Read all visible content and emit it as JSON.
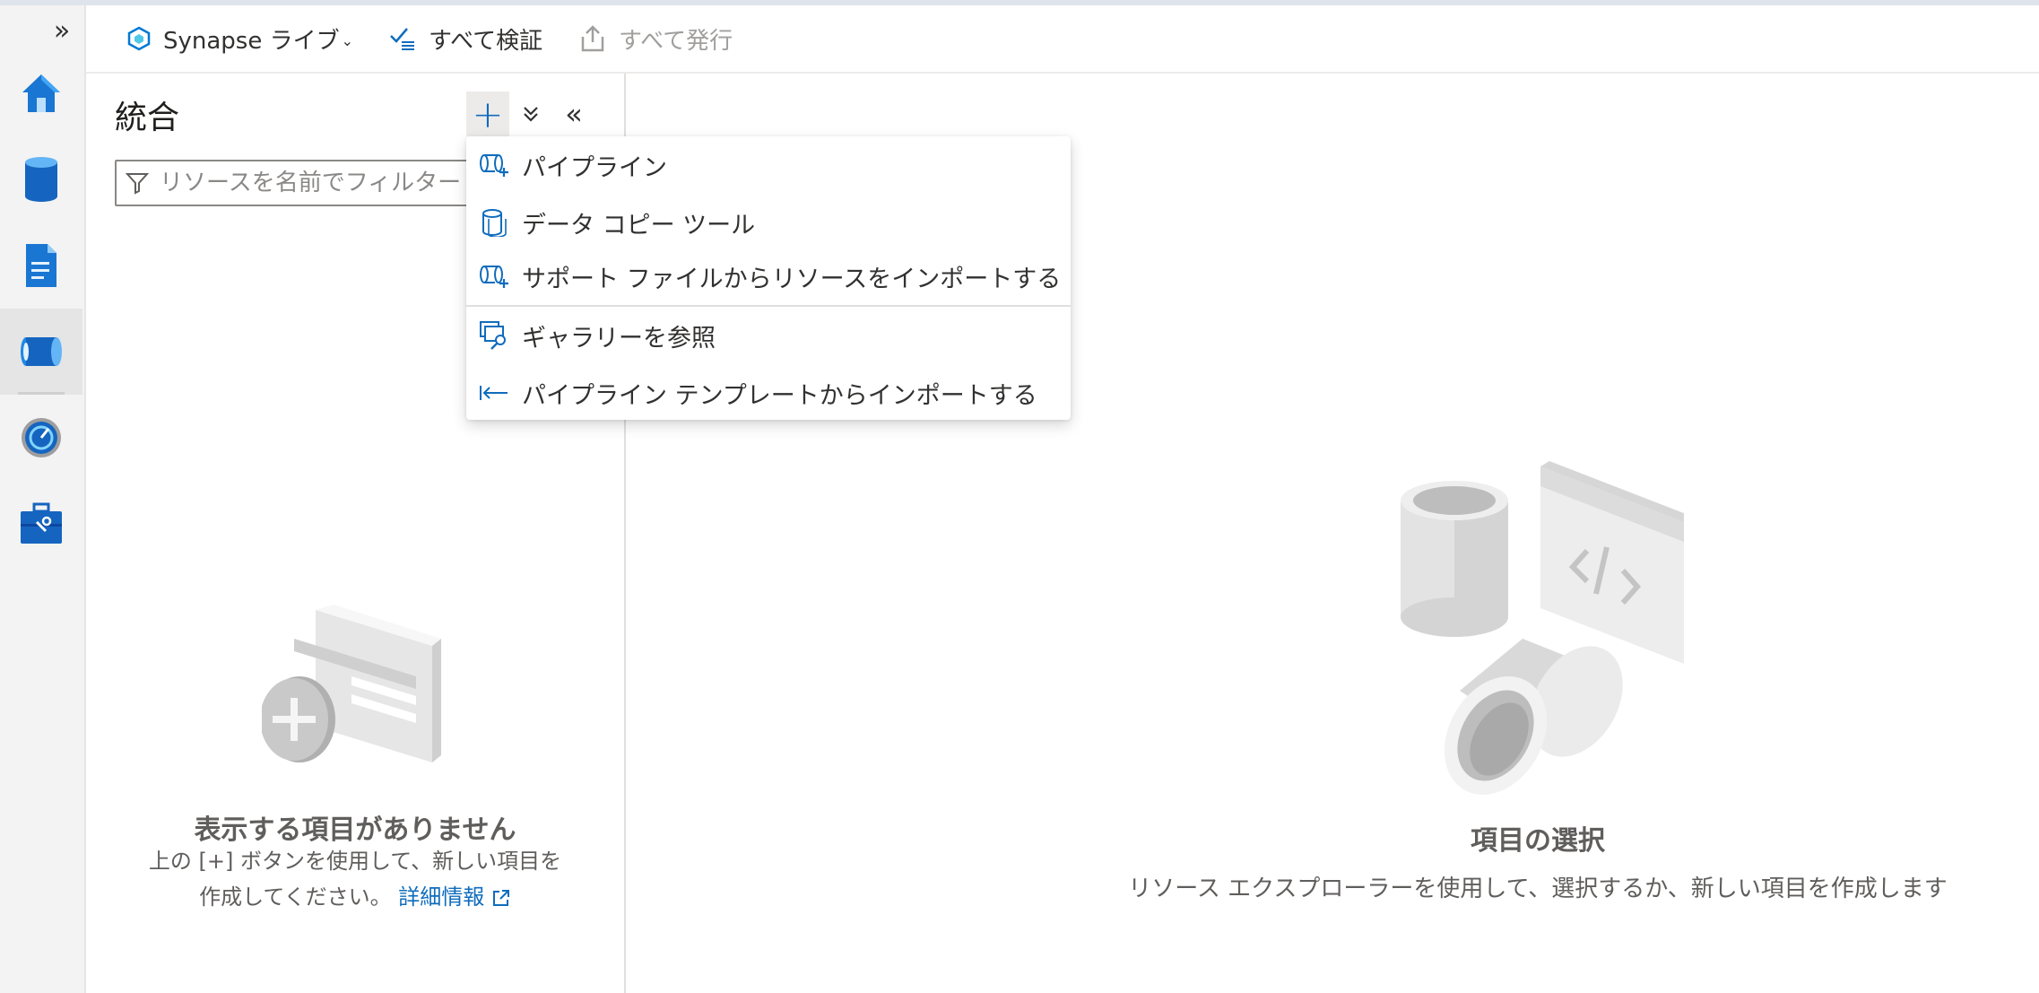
{
  "command_bar": {
    "synapse_live_label": "Synapse ライブ",
    "validate_all_label": "すべて検証",
    "publish_all_label": "すべて発行"
  },
  "explorer": {
    "title": "統合",
    "filter_placeholder": "リソースを名前でフィルター",
    "empty_title": "表示する項目がありません",
    "empty_line1": "上の [+] ボタンを使用して、新しい項目を",
    "empty_line2": "作成してください。",
    "learn_more": "詳細情報"
  },
  "add_menu": {
    "items": [
      {
        "label": "パイプライン",
        "icon": "pipeline-icon"
      },
      {
        "label": "データ コピー ツール",
        "icon": "copy-data-icon"
      },
      {
        "label": "サポート ファイルからリソースをインポートする",
        "icon": "import-resource-icon"
      },
      {
        "label": "ギャラリーを参照",
        "icon": "gallery-icon"
      },
      {
        "label": "パイプライン テンプレートからインポートする",
        "icon": "import-template-icon"
      }
    ]
  },
  "main": {
    "title": "項目の選択",
    "desc": "リソース エクスプローラーを使用して、選択するか、新しい項目を作成します"
  },
  "colors": {
    "accent": "#0f6cbd",
    "rail_background": "#f3f3f3"
  }
}
